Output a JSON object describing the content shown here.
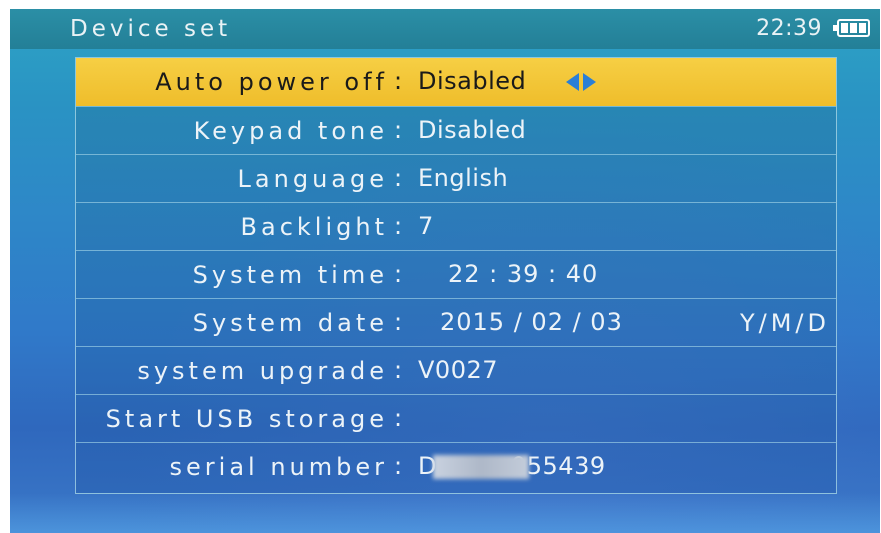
{
  "header": {
    "title": "Device set",
    "time": "22:39",
    "battery_icon": "battery-full-icon"
  },
  "settings": [
    {
      "label": "Auto power off",
      "value": "Disabled",
      "selected": true
    },
    {
      "label": "Keypad tone",
      "value": "Disabled"
    },
    {
      "label": "Language",
      "value": "English"
    },
    {
      "label": "Backlight",
      "value": "7"
    },
    {
      "label": "System time",
      "value": "22 : 39 : 40"
    },
    {
      "label": "System date",
      "value": "2015 / 02 / 03",
      "suffix": "Y/M/D"
    },
    {
      "label": "system upgrade",
      "value": "V0027"
    },
    {
      "label": "Start USB storage",
      "value": ""
    },
    {
      "label": "serial number",
      "value_prefix": "D",
      "value_suffix": "055439"
    }
  ],
  "colors": {
    "selection": "#f2c232",
    "arrow": "#2a7fd6",
    "header_bg": "#2687a0"
  }
}
